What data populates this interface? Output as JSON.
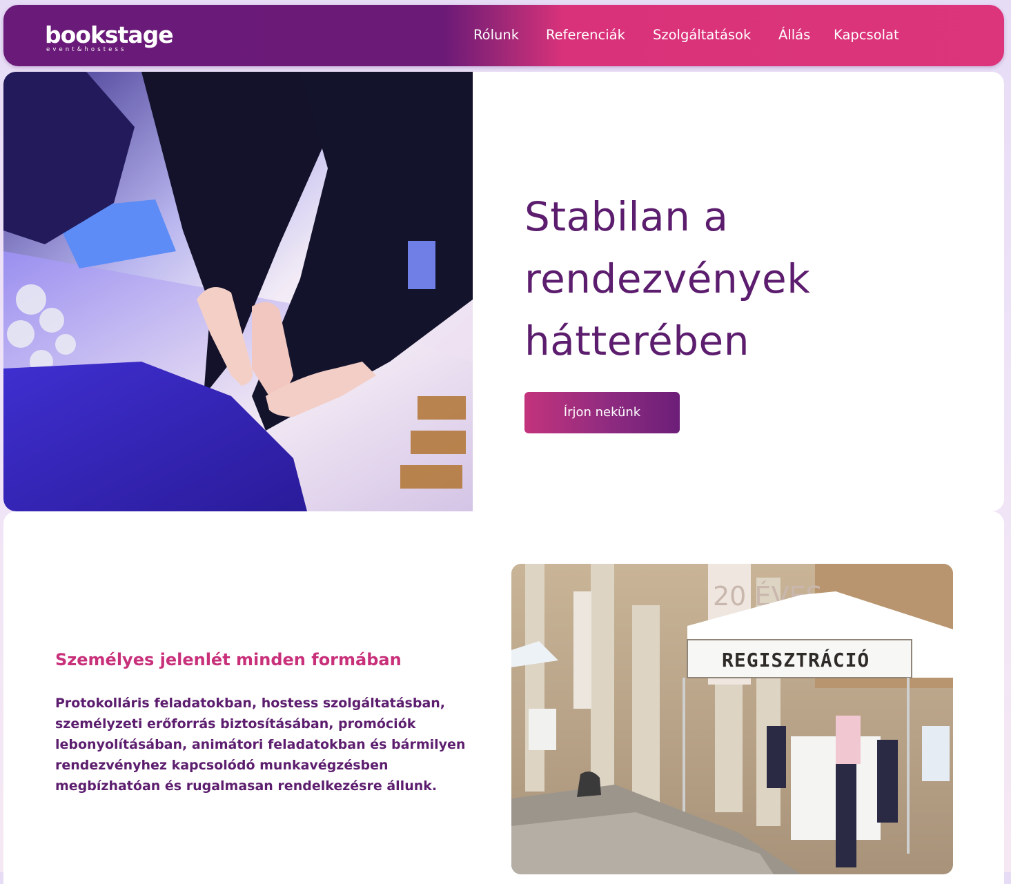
{
  "brand": {
    "logo_text": "bookstage",
    "logo_subtitle": "event&hostess"
  },
  "nav": {
    "items": [
      {
        "label": "Rólunk"
      },
      {
        "label": "Referenciák"
      },
      {
        "label": "Szolgáltatások"
      },
      {
        "label": "Állás"
      },
      {
        "label": "Kapcsolat"
      }
    ]
  },
  "hero": {
    "title_lines": [
      "Stabilan a",
      "rendezvények",
      "hátterében"
    ],
    "cta_label": "Írjon nekünk"
  },
  "section2": {
    "heading": "Személyes jelenlét minden formában",
    "text": "Protokolláris feladatokban, hostess szolgáltatásban, személyzeti erőforrás biztosításában, promóciók lebonyolításában, animátori feladatokban és bármilyen rendezvényhez kapcsolódó munkavégzésben megbízhatóan és rugalmasan rendelkezésre állunk.",
    "photo_sign": "REGISZTRÁCIÓ",
    "banner_text": "20 ÉVES"
  },
  "colors": {
    "brand_purple": "#6a1a78",
    "brand_pink": "#dc357b",
    "heading_purple": "#5c1d6e",
    "accent_pink": "#c8307a"
  }
}
